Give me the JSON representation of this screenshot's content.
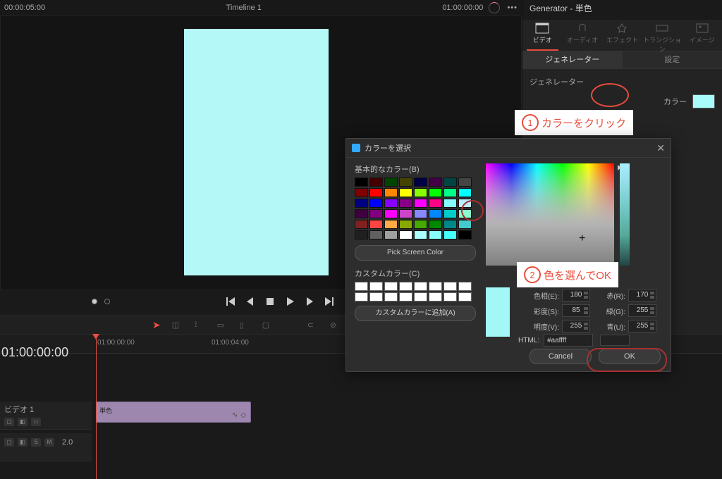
{
  "top": {
    "tc_left": "00:00:05:00",
    "timeline_name": "Timeline 1",
    "tc_right": "01:00:00:00"
  },
  "inspector": {
    "title": "Generator - 単色",
    "tabs": [
      {
        "label": "ビデオ",
        "active": true
      },
      {
        "label": "オーディオ"
      },
      {
        "label": "エフェクト"
      },
      {
        "label": "トランジション"
      },
      {
        "label": "イメージ"
      }
    ],
    "sub_tabs": [
      {
        "label": "ジェネレーター",
        "active": true
      },
      {
        "label": "設定"
      }
    ],
    "section_label": "ジェネレーター",
    "color_label": "カラー"
  },
  "dialog": {
    "title": "カラーを選択",
    "basic_label": "基本的なカラー(B)",
    "pick_screen": "Pick Screen Color",
    "custom_label": "カスタムカラー(C)",
    "add_custom": "カスタムカラーに追加(A)",
    "fields": {
      "hue_l": "色相(E):",
      "hue_v": "180",
      "sat_l": "彩度(S):",
      "sat_v": "85",
      "val_l": "明度(V):",
      "val_v": "255",
      "r_l": "赤(R):",
      "r_v": "170",
      "g_l": "緑(G):",
      "g_v": "255",
      "b_l": "青(U):",
      "b_v": "255",
      "html_l": "HTML:",
      "html_v": "#aaffff"
    },
    "cancel": "Cancel",
    "ok": "OK",
    "basic_colors": [
      "#000",
      "#400",
      "#040",
      "#440",
      "#004",
      "#404",
      "#044",
      "#444",
      "#800000",
      "#f00",
      "#f80",
      "#ff0",
      "#8f0",
      "#0f0",
      "#0f8",
      "#0ff",
      "#000080",
      "#00f",
      "#80f",
      "#808",
      "#f0f",
      "#f08",
      "#8ff",
      "#bef",
      "#400040",
      "#800080",
      "#f0f",
      "#c4c",
      "#88f",
      "#08f",
      "#0cc",
      "#8fc",
      "#802020",
      "#f44",
      "#fa4",
      "#8a0",
      "#4a0",
      "#080",
      "#088",
      "#4cc",
      "#202020",
      "#606060",
      "#a0a0a0",
      "#fff",
      "#aff",
      "#8ff",
      "#4ff",
      "#000"
    ]
  },
  "annotations": {
    "one_text": "カラーをクリック",
    "two_text": "色を選んでOK"
  },
  "timeline": {
    "big_tc": "01:00:00:00",
    "ruler": [
      {
        "pos": 136,
        "label": "01:00:00:00"
      },
      {
        "pos": 300,
        "label": "01:00:04:00"
      }
    ],
    "track_v1": "ビデオ 1",
    "a_zoom": "2.0",
    "clip_name": "単色"
  }
}
